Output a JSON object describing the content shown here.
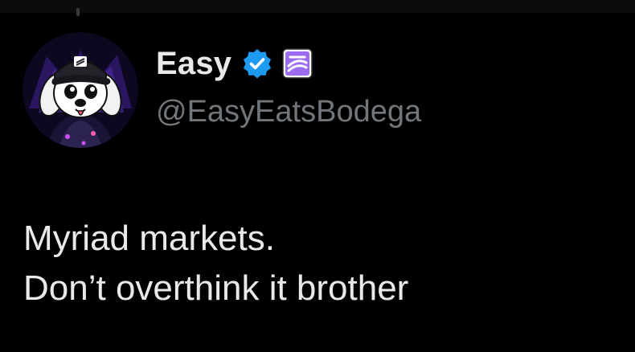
{
  "post": {
    "author": {
      "display_name": "Easy",
      "handle": "@EasyEatsBodega",
      "verified_icon": "verified-check-icon",
      "affiliate_icon": "affiliate-logo-icon"
    },
    "text_lines": [
      "Myriad markets.",
      "Don’t overthink it brother"
    ]
  },
  "colors": {
    "background": "#000000",
    "primary_text": "#e7e9ea",
    "secondary_text": "#71767b",
    "verified_blue": "#1d9bf0",
    "affiliate_purple": "#9b6cf0"
  }
}
